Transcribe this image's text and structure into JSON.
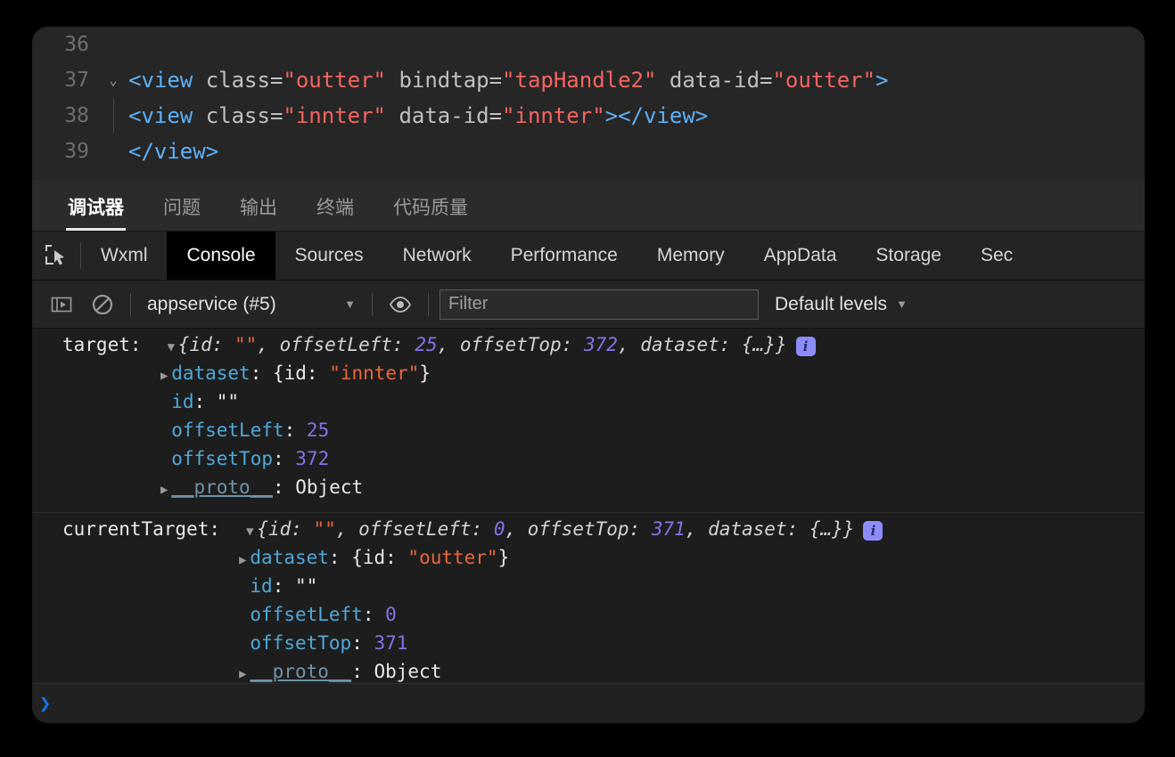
{
  "editor": {
    "lines": [
      {
        "num": "36",
        "fold": "",
        "guide": false,
        "segments": []
      },
      {
        "num": "37",
        "fold": "chevron-down",
        "guide": false,
        "segments": [
          {
            "t": "<view ",
            "c": "tag"
          },
          {
            "t": "class=",
            "c": "attr"
          },
          {
            "t": "\"outter\"",
            "c": "str"
          },
          {
            "t": " bindtap=",
            "c": "attr"
          },
          {
            "t": "\"tapHandle2\"",
            "c": "str"
          },
          {
            "t": " data-id=",
            "c": "attr"
          },
          {
            "t": "\"outter\"",
            "c": "str"
          },
          {
            "t": ">",
            "c": "tag"
          }
        ]
      },
      {
        "num": "38",
        "fold": "",
        "guide": true,
        "segments": [
          {
            "t": "<view ",
            "c": "tag"
          },
          {
            "t": "class=",
            "c": "attr"
          },
          {
            "t": "\"innter\"",
            "c": "str"
          },
          {
            "t": " data-id=",
            "c": "attr"
          },
          {
            "t": "\"innter\"",
            "c": "str"
          },
          {
            "t": ">",
            "c": "tag"
          },
          {
            "t": "</view>",
            "c": "tag"
          }
        ]
      },
      {
        "num": "39",
        "fold": "",
        "guide": false,
        "segments": [
          {
            "t": "</view>",
            "c": "tag"
          }
        ]
      }
    ]
  },
  "panel_tabs": [
    {
      "label": "调试器",
      "active": true
    },
    {
      "label": "问题",
      "active": false
    },
    {
      "label": "输出",
      "active": false
    },
    {
      "label": "终端",
      "active": false
    },
    {
      "label": "代码质量",
      "active": false
    }
  ],
  "devtools_tabs": [
    {
      "label": "Wxml",
      "active": false
    },
    {
      "label": "Console",
      "active": true
    },
    {
      "label": "Sources",
      "active": false
    },
    {
      "label": "Network",
      "active": false
    },
    {
      "label": "Performance",
      "active": false
    },
    {
      "label": "Memory",
      "active": false
    },
    {
      "label": "AppData",
      "active": false
    },
    {
      "label": "Storage",
      "active": false
    },
    {
      "label": "Sec",
      "active": false
    }
  ],
  "console_toolbar": {
    "inspect_icon": "inspect-element-icon",
    "sidebar_icon": "console-sidebar-icon",
    "clear_icon": "clear-console-icon",
    "eye_icon": "live-expression-icon",
    "context": "appservice (#5)",
    "context_caret": "▼",
    "filter_placeholder": "Filter",
    "filter_value": "",
    "levels": "Default levels",
    "levels_caret": "▼"
  },
  "console_messages": [
    {
      "label": "target:",
      "expanded": true,
      "preview": [
        {
          "t": "{id: ",
          "c": "preview"
        },
        {
          "t": "\"\"",
          "c": "s"
        },
        {
          "t": ", offsetLeft: ",
          "c": "preview"
        },
        {
          "t": "25",
          "c": "n"
        },
        {
          "t": ", offsetTop: ",
          "c": "preview"
        },
        {
          "t": "372",
          "c": "n"
        },
        {
          "t": ", dataset: {…}}",
          "c": "preview"
        }
      ],
      "badge": "i",
      "props": [
        {
          "arrow": "▶",
          "segments": [
            {
              "t": "dataset",
              "c": "k"
            },
            {
              "t": ": {id: ",
              "c": "plain"
            },
            {
              "t": "\"innter\"",
              "c": "s"
            },
            {
              "t": "}",
              "c": "plain"
            }
          ]
        },
        {
          "arrow": "",
          "segments": [
            {
              "t": "id",
              "c": "k"
            },
            {
              "t": ": ",
              "c": "plain"
            },
            {
              "t": "\"\"",
              "c": "plain"
            }
          ]
        },
        {
          "arrow": "",
          "segments": [
            {
              "t": "offsetLeft",
              "c": "k"
            },
            {
              "t": ": ",
              "c": "plain"
            },
            {
              "t": "25",
              "c": "n"
            }
          ]
        },
        {
          "arrow": "",
          "segments": [
            {
              "t": "offsetTop",
              "c": "k"
            },
            {
              "t": ": ",
              "c": "plain"
            },
            {
              "t": "372",
              "c": "n"
            }
          ]
        },
        {
          "arrow": "▶",
          "segments": [
            {
              "t": "__proto__",
              "c": "proto"
            },
            {
              "t": ": Object",
              "c": "plain"
            }
          ]
        }
      ]
    },
    {
      "label": "currentTarget:",
      "expanded": true,
      "preview": [
        {
          "t": "{id: ",
          "c": "preview"
        },
        {
          "t": "\"\"",
          "c": "s"
        },
        {
          "t": ", offsetLeft: ",
          "c": "preview"
        },
        {
          "t": "0",
          "c": "n"
        },
        {
          "t": ", offsetTop: ",
          "c": "preview"
        },
        {
          "t": "371",
          "c": "n"
        },
        {
          "t": ", dataset: {…}}",
          "c": "preview"
        }
      ],
      "badge": "i",
      "props": [
        {
          "arrow": "▶",
          "segments": [
            {
              "t": "dataset",
              "c": "k"
            },
            {
              "t": ": {id: ",
              "c": "plain"
            },
            {
              "t": "\"outter\"",
              "c": "s"
            },
            {
              "t": "}",
              "c": "plain"
            }
          ]
        },
        {
          "arrow": "",
          "segments": [
            {
              "t": "id",
              "c": "k"
            },
            {
              "t": ": ",
              "c": "plain"
            },
            {
              "t": "\"\"",
              "c": "plain"
            }
          ]
        },
        {
          "arrow": "",
          "segments": [
            {
              "t": "offsetLeft",
              "c": "k"
            },
            {
              "t": ": ",
              "c": "plain"
            },
            {
              "t": "0",
              "c": "n"
            }
          ]
        },
        {
          "arrow": "",
          "segments": [
            {
              "t": "offsetTop",
              "c": "k"
            },
            {
              "t": ": ",
              "c": "plain"
            },
            {
              "t": "371",
              "c": "n"
            }
          ]
        },
        {
          "arrow": "▶",
          "segments": [
            {
              "t": "__proto__",
              "c": "proto"
            },
            {
              "t": ": Object",
              "c": "plain"
            }
          ]
        }
      ]
    }
  ],
  "prompt": {
    "caret": "❯",
    "value": ""
  },
  "colors": {
    "background": "#000000",
    "panel": "#202020",
    "editor": "#262626",
    "console": "#1d1d1d",
    "toolbar": "#242424",
    "key": "#4fa8d8",
    "string": "#e8663c",
    "number": "#8a6fe8",
    "tag": "#5db0f7",
    "attr_string": "#f4645f",
    "badge": "#8d8dfa",
    "prompt": "#1a73e8"
  }
}
